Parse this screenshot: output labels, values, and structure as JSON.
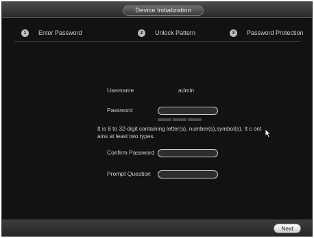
{
  "window": {
    "title": "Device Initialization"
  },
  "steps": [
    {
      "number": "1",
      "label": "Enter Password"
    },
    {
      "number": "2",
      "label": "Unlock Pattern"
    },
    {
      "number": "3",
      "label": "Password Protection"
    }
  ],
  "form": {
    "username_label": "Username",
    "username_value": "admin",
    "password_label": "Password",
    "password_hint": "It is 8 to 32-digit containing letter(s), number(s),symbol(s). It c ontains at least two types.",
    "confirm_label": "Confirm Password",
    "prompt_label": "Prompt Question"
  },
  "footer": {
    "next_label": "Next"
  },
  "icons": {
    "cursor": "mouse-pointer-icon"
  }
}
